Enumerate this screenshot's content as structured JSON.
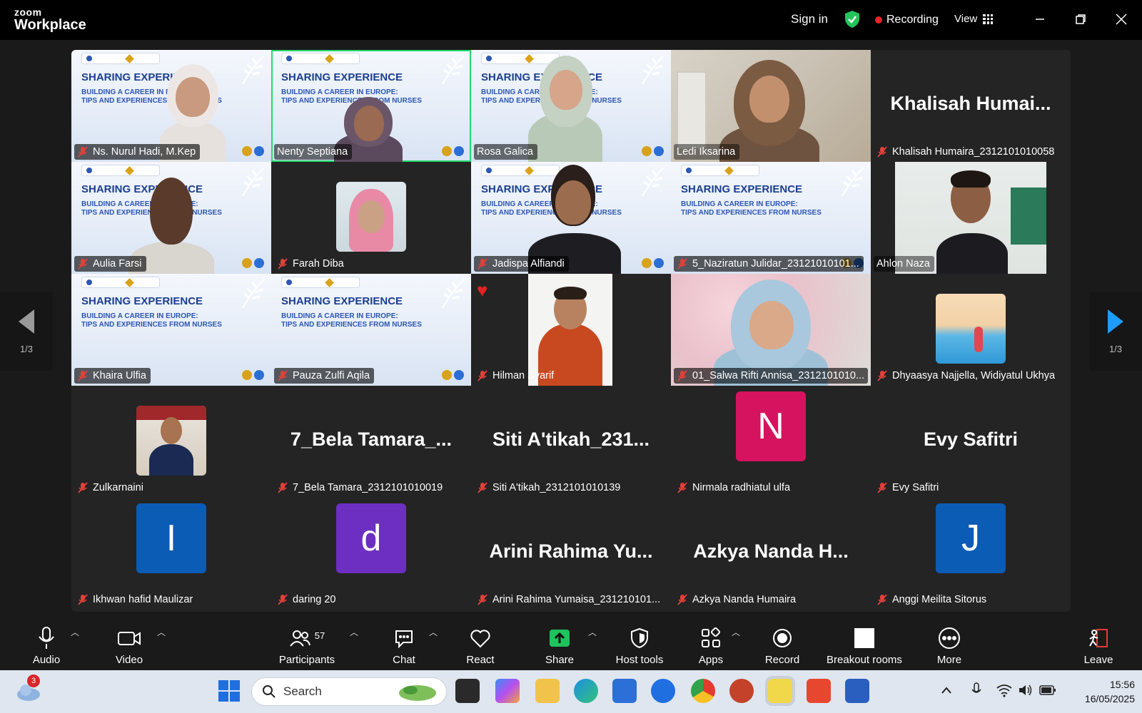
{
  "app": {
    "logo_line1": "zoom",
    "logo_line2": "Workplace"
  },
  "titlebar": {
    "sign_in": "Sign in",
    "recording": "Recording",
    "view": "View"
  },
  "slide": {
    "title": "SHARING EXPERIENCE",
    "sub1": "BUILDING A CAREER IN EUROPE:",
    "sub2": "TIPS AND EXPERIENCES FROM NURSES"
  },
  "nav": {
    "page_left": "1/3",
    "page_right": "1/3"
  },
  "participants": {
    "ns_nurul": "Ns. Nurul Hadi, M.Kep",
    "nenty": "Nenty Septiana",
    "rosa": "Rosa Galica",
    "ledi": "Ledi Iksarina",
    "khalisah_big": "Khalisah  Humai...",
    "khalisah": "Khalisah Humaira_2312101010058",
    "aulia": "Aulia Farsi",
    "farah": "Farah Diba",
    "jadispa": "Jadispa Alfiandi",
    "naziratun": "5_Naziratun Julidar_23121010101...",
    "ahlon": "Ahlon Naza",
    "khaira": "Khaira Ulfia",
    "pauza": "Pauza Zulfi Aqila",
    "hilman": "Hilman Syarif",
    "salwa": "01_Salwa Rifti Annisa_2312101010...",
    "dhyaasya": "Dhyaasya Najjella, Widiyatul Ukhya",
    "zulkarnaini": "Zulkarnaini",
    "bela_big": "7_Bela  Tamara_...",
    "bela": "7_Bela Tamara_2312101010019",
    "siti_big": "Siti  A'tikah_231...",
    "siti": "Siti A'tikah_2312101010139",
    "nirmala_initial": "N",
    "nirmala": "Nirmala radhiatul ulfa",
    "evy_big": "Evy Safitri",
    "evy": "Evy Safitri",
    "ikhwan_initial": "I",
    "ikhwan": "Ikhwan hafid Maulizar",
    "daring_initial": "d",
    "daring": "daring 20",
    "arini_big": "Arini  Rahima  Yu...",
    "arini": "Arini Rahima Yumaisa_231210101...",
    "azkya_big": "Azkya  Nanda  H...",
    "azkya": "Azkya Nanda Humaira",
    "anggi_initial": "J",
    "anggi": "Anggi Meilita Sitorus"
  },
  "toolbar": {
    "audio": "Audio",
    "video": "Video",
    "participants": "Participants",
    "participants_count": "57",
    "chat": "Chat",
    "react": "React",
    "share": "Share",
    "host_tools": "Host tools",
    "apps": "Apps",
    "record": "Record",
    "breakout": "Breakout rooms",
    "more": "More",
    "leave": "Leave"
  },
  "taskbar": {
    "search_placeholder": "Search",
    "weather_badge": "3",
    "time": "15:56",
    "date": "16/05/2025"
  },
  "colors": {
    "active_speaker": "#23d96b",
    "recording_dot": "#e02828",
    "share_green": "#1fc35b",
    "avatar_magenta": "#d6135f",
    "avatar_blue": "#0b5cb5",
    "avatar_purple": "#6d2fc2"
  }
}
